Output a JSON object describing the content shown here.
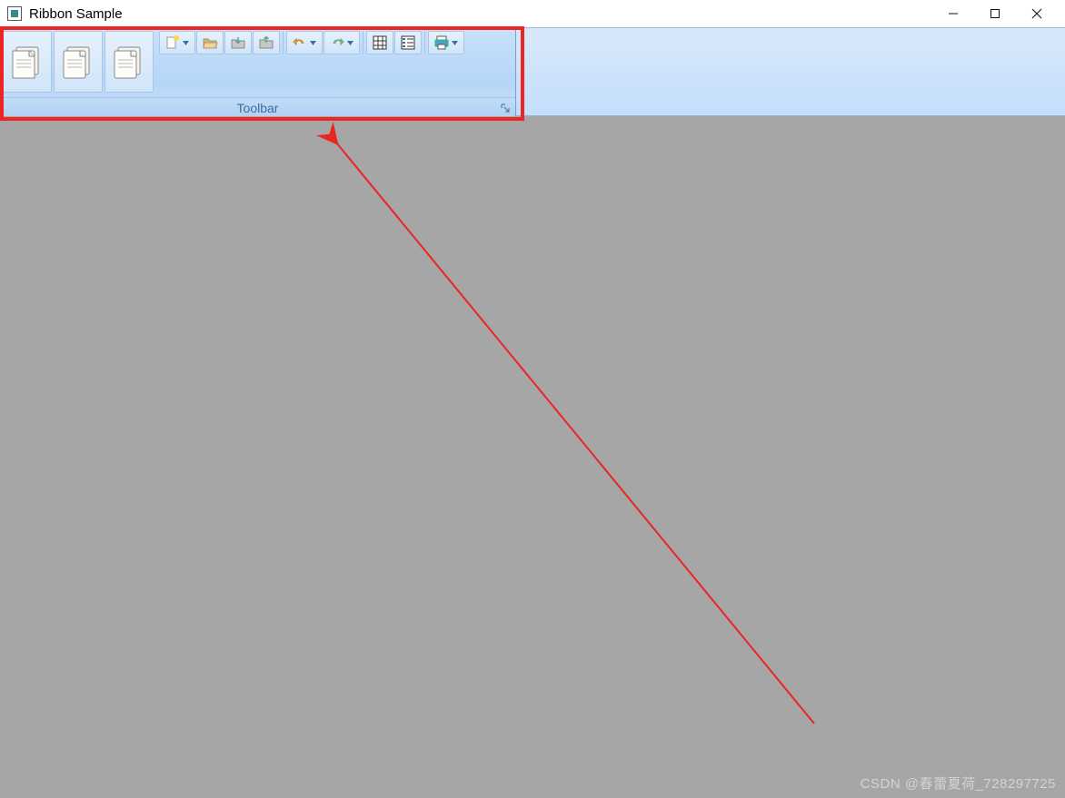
{
  "window": {
    "title": "Ribbon Sample"
  },
  "ribbon": {
    "group_label": "Toolbar",
    "buttons": {
      "doc1": "document-icon",
      "doc2": "document-icon",
      "doc3": "document-icon",
      "new": "new-file-icon",
      "open": "open-folder-icon",
      "save": "save-icon",
      "saveas": "save-as-icon",
      "undo": "undo-icon",
      "redo": "redo-icon",
      "grid": "grid-view-icon",
      "list": "list-view-icon",
      "print": "print-icon"
    }
  },
  "watermark": "CSDN @春蕾夏荷_728297725"
}
